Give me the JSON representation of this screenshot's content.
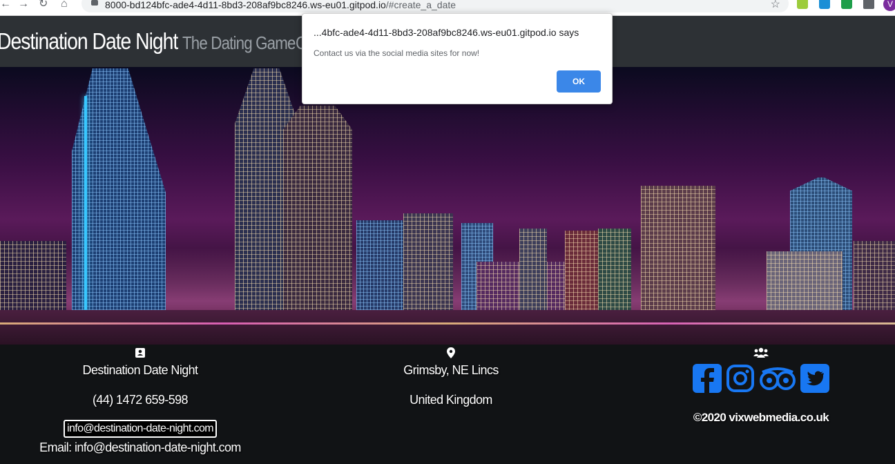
{
  "browser": {
    "url_host": "8000-bd124bfc-ade4-4d11-8bd3-208af9bc8246.ws-eu01.gitpod.io",
    "url_path": "/#create_a_date",
    "profile_initial": "V"
  },
  "navbar": {
    "brand": "Destination Date Night",
    "tagline": "The Dating Game",
    "partial_link": "C"
  },
  "dialog": {
    "title": "...4bfc-ade4-4d11-8bd3-208af9bc8246.ws-eu01.gitpod.io says",
    "message": "Contact us via the social media sites for now!",
    "ok_label": "OK"
  },
  "footer": {
    "contact": {
      "icon": "address-card-icon",
      "name": "Destination Date Night",
      "phone": "(44) 1472 659-598",
      "email_button": "info@destination-date-night.com",
      "email_line": "Email: info@destination-date-night.com"
    },
    "location": {
      "icon": "map-marker-icon",
      "city": "Grimsby, NE Lincs",
      "country": "United Kingdom"
    },
    "social": {
      "icon": "users-icon",
      "networks": [
        "facebook-icon",
        "instagram-icon",
        "tripadvisor-icon",
        "twitter-icon"
      ],
      "copyright": "©2020 vixwebmedia.co.uk",
      "icon_color": "#1877f2"
    }
  }
}
